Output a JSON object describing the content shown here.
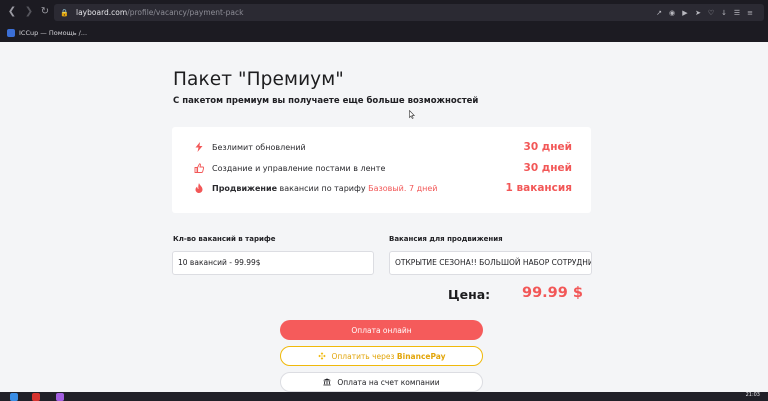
{
  "browser": {
    "url_host": "layboard.com",
    "url_path": "/profile/vacancy/payment-pack",
    "bookmark_label": "ICCup — Помощь /..."
  },
  "page": {
    "title": "Пакет \"Премиум\"",
    "subtitle": "С пакетом премиум вы получаете еще больше возможностей",
    "features": [
      {
        "icon": "lightning-icon",
        "text": "Безлимит обновлений",
        "value": "30 дней"
      },
      {
        "icon": "thumbs-up-icon",
        "text": "Создание и управление постами в ленте",
        "value": "30 дней"
      },
      {
        "icon": "flame-icon",
        "bold": "Продвижение",
        "text": " вакансии по тарифу ",
        "highlight": "Базовый. 7 дней",
        "value": "1 вакансия"
      }
    ],
    "vacancies_count_label": "Кл-во вакансий в тарифе",
    "vacancies_count_value": "10 вакансий - 99.99$",
    "promo_vacancy_label": "Вакансия для продвижения",
    "promo_vacancy_value": "ОТКРЫТИЕ СЕЗОНА!! БОЛЬШОЙ НАБОР СОТРУДНИК",
    "price_label": "Цена:",
    "price_value": "99.99 $",
    "buttons": {
      "online": "Оплата онлайн",
      "binance_prefix": "Оплатить через",
      "binance_brand": "BinancePay",
      "company": "Оплата на счет компании"
    }
  },
  "taskbar": {
    "clock": "21:03"
  },
  "colors": {
    "accent": "#f25757",
    "binance": "#f0b90b"
  }
}
